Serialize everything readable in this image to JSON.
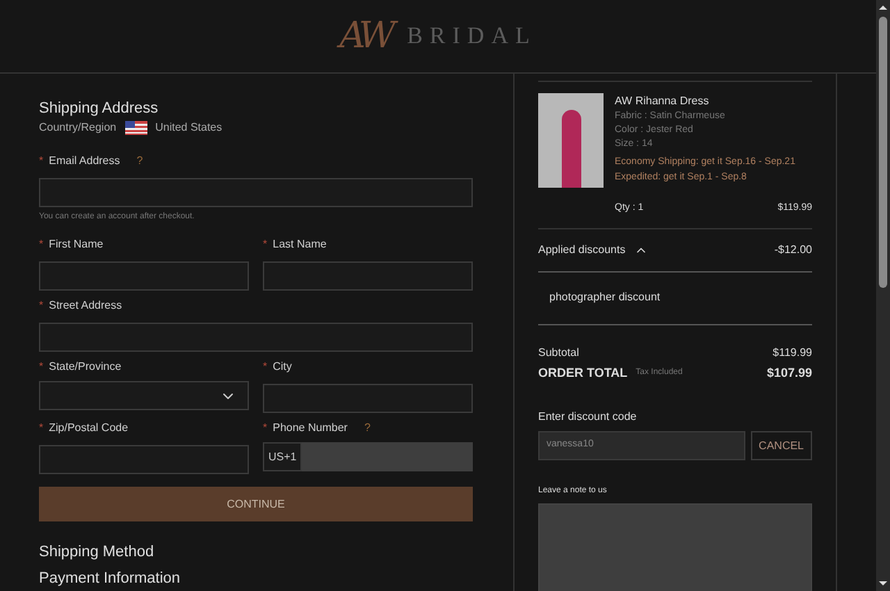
{
  "header": {
    "logo_mark": "AW",
    "logo_word": "BRIDAL"
  },
  "shipping_address": {
    "title": "Shipping Address",
    "country_label": "Country/Region",
    "country": "United States",
    "required_mark": "*",
    "fields": [
      {
        "kind": "text",
        "label": "Email Address",
        "required": true,
        "help": "?",
        "full": true,
        "hint": "You can create an account after checkout."
      },
      {
        "kind": "text",
        "label": "First Name",
        "required": true,
        "full": false
      },
      {
        "kind": "text",
        "label": "Last Name",
        "required": true,
        "full": false
      },
      {
        "kind": "text",
        "label": "Street Address",
        "required": true,
        "full": true
      },
      {
        "kind": "select",
        "label": "State/Province",
        "required": true,
        "full": false
      },
      {
        "kind": "text",
        "label": "City",
        "required": true,
        "full": false
      },
      {
        "kind": "text",
        "label": "Zip/Postal Code",
        "required": true,
        "full": false
      },
      {
        "kind": "phone",
        "label": "Phone Number",
        "required": true,
        "help": "?",
        "full": false,
        "prefix": "US+1"
      }
    ],
    "continue_button": "CONTINUE"
  },
  "sections": [
    "Shipping Method",
    "Payment Information"
  ],
  "order": {
    "item": {
      "name": "AW Rihanna Dress",
      "details": [
        "Fabric : Satin Charmeuse",
        "Color : Jester Red",
        "Size : 14"
      ],
      "shipping": [
        "Economy Shipping: get it Sep.16 - Sep.21",
        "Expedited: get it Sep.1 - Sep.8"
      ],
      "qty": "Qty : 1",
      "price": "$119.99"
    },
    "discounts": {
      "label": "Applied discounts",
      "expanded": true,
      "amount": "-$12.00",
      "items": [
        "photographer discount"
      ]
    },
    "subtotal_label": "Subtotal",
    "subtotal": "$119.99",
    "total_label": "ORDER TOTAL",
    "tax_note": "Tax Included",
    "total": "$107.99",
    "discount_code": {
      "label": "Enter discount code",
      "value": "vanessa10",
      "button": "CANCEL"
    },
    "note": {
      "label": "Leave a note to us"
    }
  }
}
